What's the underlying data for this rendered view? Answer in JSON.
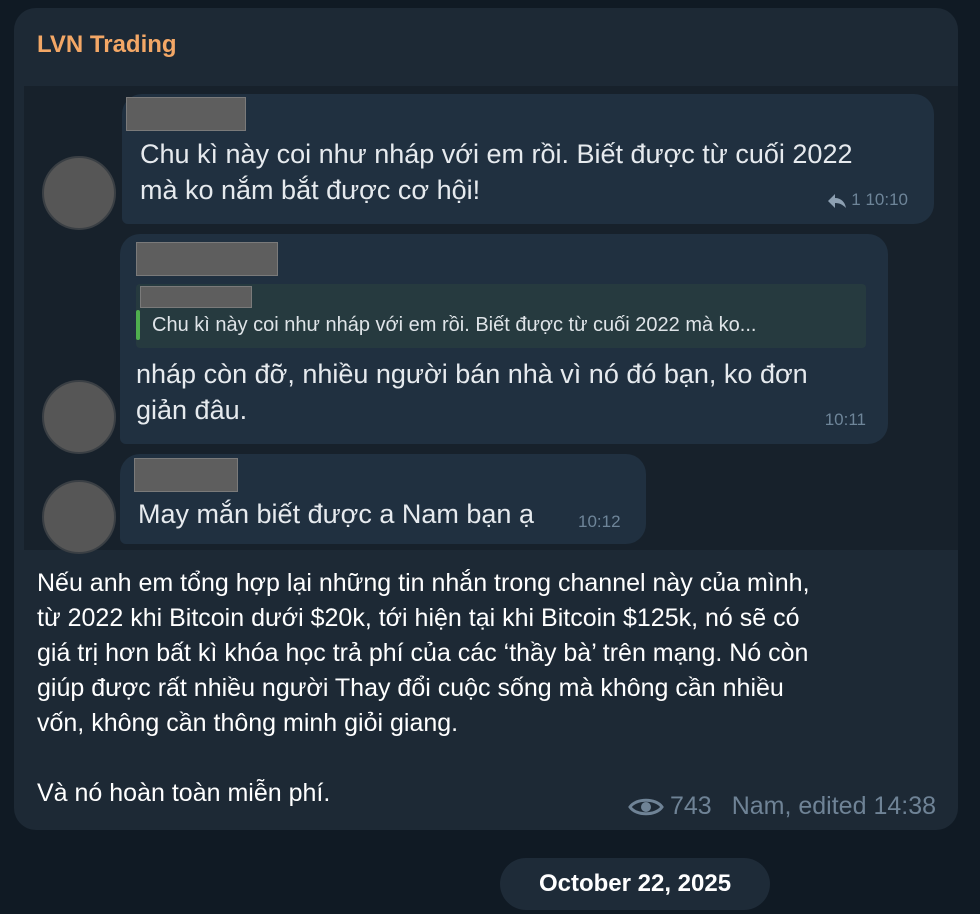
{
  "channel": {
    "name": "LVN Trading"
  },
  "screenshot_messages": [
    {
      "text_lines": [
        "Chu kì này coi như nháp với em rồi. Biết được từ cuối 2022",
        "mà ko nắm bắt được cơ hội!"
      ],
      "replies": "1",
      "time": "10:10"
    },
    {
      "quote": "Chu kì này coi như nháp với em rồi. Biết được từ cuối 2022 mà ko...",
      "text_lines": [
        "nháp còn đỡ, nhiều người bán nhà vì nó đó bạn, ko đơn",
        "giản đâu."
      ],
      "time": "10:11"
    },
    {
      "text_lines": [
        "May mắn biết được a Nam bạn ạ"
      ],
      "time": "10:12"
    }
  ],
  "post": {
    "lines": [
      "Nếu anh em tổng hợp lại những tin nhắn trong channel này của mình,",
      "từ 2022 khi Bitcoin dưới $20k, tới hiện tại khi Bitcoin $125k, nó sẽ có",
      "giá trị hơn bất kì khóa học trả phí của các ‘thầy bà’ trên mạng. Nó còn",
      "giúp được rất nhiều người Thay đổi cuộc sống mà không cần nhiều",
      "vốn, không cần thông minh giỏi giang."
    ],
    "closing": "Và nó hoàn toàn miễn phí.",
    "views": "743",
    "author_edited": "Nam, edited 14:38"
  },
  "date_separator": "October 22, 2025",
  "colors": {
    "channel_name": "#f3a766",
    "reply_bar": "#4fae4e",
    "background": "#101a24"
  },
  "icons": {
    "views": "eye-icon",
    "reply": "reply-arrow-icon"
  }
}
